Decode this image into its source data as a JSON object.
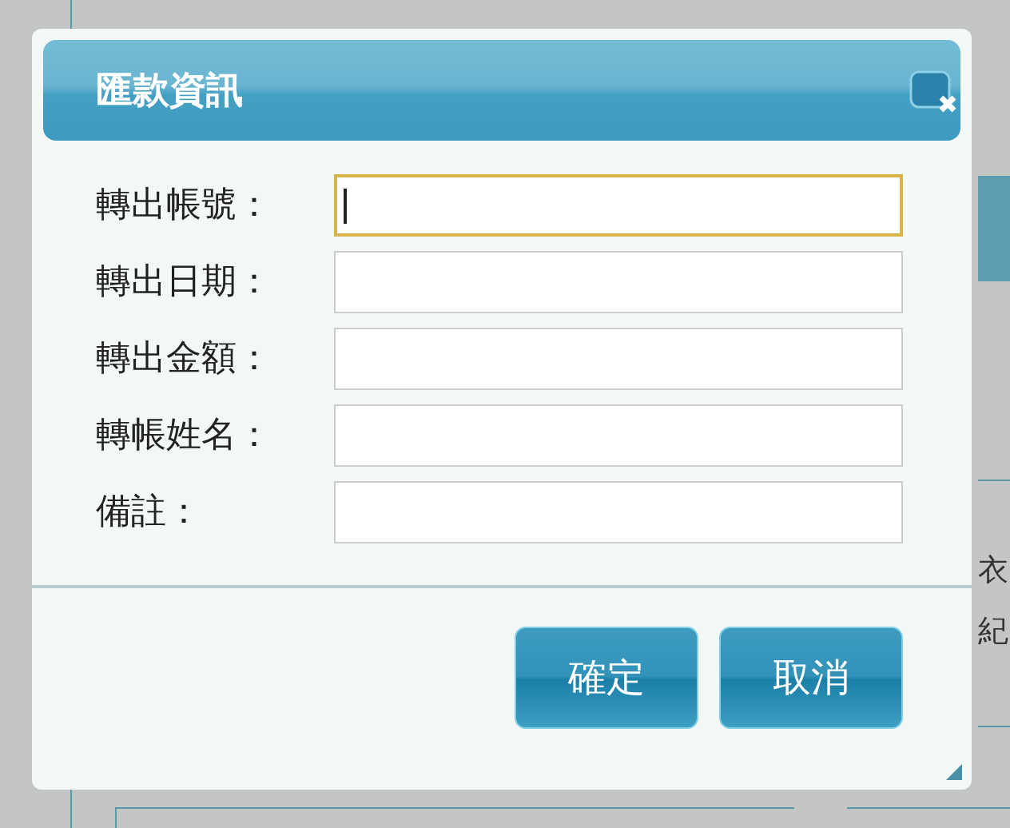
{
  "dialog": {
    "title": "匯款資訊",
    "fields": [
      {
        "label": "轉出帳號：",
        "focused": true
      },
      {
        "label": "轉出日期：",
        "focused": false
      },
      {
        "label": "轉出金額：",
        "focused": false
      },
      {
        "label": "轉帳姓名：",
        "focused": false
      },
      {
        "label": "備註：",
        "focused": false
      }
    ],
    "buttons": [
      "確定",
      "取消"
    ]
  },
  "background_texts": [
    "衣",
    "紀"
  ]
}
